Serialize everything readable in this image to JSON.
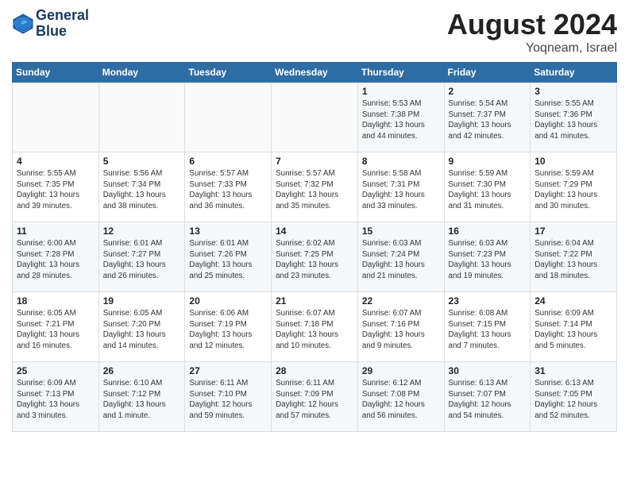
{
  "header": {
    "logo_line1": "General",
    "logo_line2": "Blue",
    "month": "August 2024",
    "location": "Yoqneam, Israel"
  },
  "days_of_week": [
    "Sunday",
    "Monday",
    "Tuesday",
    "Wednesday",
    "Thursday",
    "Friday",
    "Saturday"
  ],
  "weeks": [
    [
      {
        "day": "",
        "info": ""
      },
      {
        "day": "",
        "info": ""
      },
      {
        "day": "",
        "info": ""
      },
      {
        "day": "",
        "info": ""
      },
      {
        "day": "1",
        "info": "Sunrise: 5:53 AM\nSunset: 7:38 PM\nDaylight: 13 hours\nand 44 minutes."
      },
      {
        "day": "2",
        "info": "Sunrise: 5:54 AM\nSunset: 7:37 PM\nDaylight: 13 hours\nand 42 minutes."
      },
      {
        "day": "3",
        "info": "Sunrise: 5:55 AM\nSunset: 7:36 PM\nDaylight: 13 hours\nand 41 minutes."
      }
    ],
    [
      {
        "day": "4",
        "info": "Sunrise: 5:55 AM\nSunset: 7:35 PM\nDaylight: 13 hours\nand 39 minutes."
      },
      {
        "day": "5",
        "info": "Sunrise: 5:56 AM\nSunset: 7:34 PM\nDaylight: 13 hours\nand 38 minutes."
      },
      {
        "day": "6",
        "info": "Sunrise: 5:57 AM\nSunset: 7:33 PM\nDaylight: 13 hours\nand 36 minutes."
      },
      {
        "day": "7",
        "info": "Sunrise: 5:57 AM\nSunset: 7:32 PM\nDaylight: 13 hours\nand 35 minutes."
      },
      {
        "day": "8",
        "info": "Sunrise: 5:58 AM\nSunset: 7:31 PM\nDaylight: 13 hours\nand 33 minutes."
      },
      {
        "day": "9",
        "info": "Sunrise: 5:59 AM\nSunset: 7:30 PM\nDaylight: 13 hours\nand 31 minutes."
      },
      {
        "day": "10",
        "info": "Sunrise: 5:59 AM\nSunset: 7:29 PM\nDaylight: 13 hours\nand 30 minutes."
      }
    ],
    [
      {
        "day": "11",
        "info": "Sunrise: 6:00 AM\nSunset: 7:28 PM\nDaylight: 13 hours\nand 28 minutes."
      },
      {
        "day": "12",
        "info": "Sunrise: 6:01 AM\nSunset: 7:27 PM\nDaylight: 13 hours\nand 26 minutes."
      },
      {
        "day": "13",
        "info": "Sunrise: 6:01 AM\nSunset: 7:26 PM\nDaylight: 13 hours\nand 25 minutes."
      },
      {
        "day": "14",
        "info": "Sunrise: 6:02 AM\nSunset: 7:25 PM\nDaylight: 13 hours\nand 23 minutes."
      },
      {
        "day": "15",
        "info": "Sunrise: 6:03 AM\nSunset: 7:24 PM\nDaylight: 13 hours\nand 21 minutes."
      },
      {
        "day": "16",
        "info": "Sunrise: 6:03 AM\nSunset: 7:23 PM\nDaylight: 13 hours\nand 19 minutes."
      },
      {
        "day": "17",
        "info": "Sunrise: 6:04 AM\nSunset: 7:22 PM\nDaylight: 13 hours\nand 18 minutes."
      }
    ],
    [
      {
        "day": "18",
        "info": "Sunrise: 6:05 AM\nSunset: 7:21 PM\nDaylight: 13 hours\nand 16 minutes."
      },
      {
        "day": "19",
        "info": "Sunrise: 6:05 AM\nSunset: 7:20 PM\nDaylight: 13 hours\nand 14 minutes."
      },
      {
        "day": "20",
        "info": "Sunrise: 6:06 AM\nSunset: 7:19 PM\nDaylight: 13 hours\nand 12 minutes."
      },
      {
        "day": "21",
        "info": "Sunrise: 6:07 AM\nSunset: 7:18 PM\nDaylight: 13 hours\nand 10 minutes."
      },
      {
        "day": "22",
        "info": "Sunrise: 6:07 AM\nSunset: 7:16 PM\nDaylight: 13 hours\nand 9 minutes."
      },
      {
        "day": "23",
        "info": "Sunrise: 6:08 AM\nSunset: 7:15 PM\nDaylight: 13 hours\nand 7 minutes."
      },
      {
        "day": "24",
        "info": "Sunrise: 6:09 AM\nSunset: 7:14 PM\nDaylight: 13 hours\nand 5 minutes."
      }
    ],
    [
      {
        "day": "25",
        "info": "Sunrise: 6:09 AM\nSunset: 7:13 PM\nDaylight: 13 hours\nand 3 minutes."
      },
      {
        "day": "26",
        "info": "Sunrise: 6:10 AM\nSunset: 7:12 PM\nDaylight: 13 hours\nand 1 minute."
      },
      {
        "day": "27",
        "info": "Sunrise: 6:11 AM\nSunset: 7:10 PM\nDaylight: 12 hours\nand 59 minutes."
      },
      {
        "day": "28",
        "info": "Sunrise: 6:11 AM\nSunset: 7:09 PM\nDaylight: 12 hours\nand 57 minutes."
      },
      {
        "day": "29",
        "info": "Sunrise: 6:12 AM\nSunset: 7:08 PM\nDaylight: 12 hours\nand 56 minutes."
      },
      {
        "day": "30",
        "info": "Sunrise: 6:13 AM\nSunset: 7:07 PM\nDaylight: 12 hours\nand 54 minutes."
      },
      {
        "day": "31",
        "info": "Sunrise: 6:13 AM\nSunset: 7:05 PM\nDaylight: 12 hours\nand 52 minutes."
      }
    ]
  ]
}
